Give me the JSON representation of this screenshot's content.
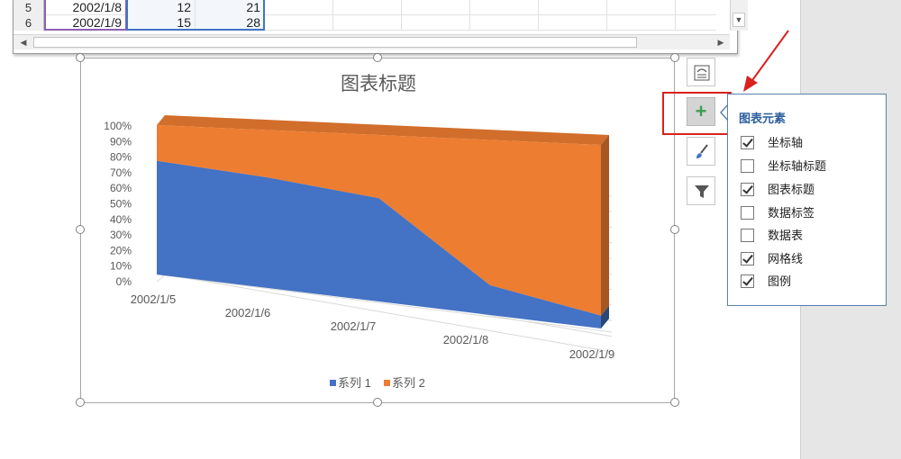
{
  "spreadsheet": {
    "rows": [
      {
        "num": "5",
        "date": "2002/1/8",
        "v1": "12",
        "v2": "21"
      },
      {
        "num": "6",
        "date": "2002/1/9",
        "v1": "15",
        "v2": "28"
      }
    ],
    "scroll_down_icon": "triangle-down",
    "scroll_left_icon": "triangle-left",
    "scroll_right_icon": "triangle-right"
  },
  "chart": {
    "title": "图表标题"
  },
  "chart_data": {
    "type": "area",
    "stacked": "percent",
    "three_d": true,
    "categories": [
      "2002/1/5",
      "2002/1/6",
      "2002/1/7",
      "2002/1/8",
      "2002/1/9"
    ],
    "series": [
      {
        "name": "系列 1",
        "values": [
          76,
          70,
          62,
          17,
          7
        ],
        "color": "#4472c4"
      },
      {
        "name": "系列 2",
        "values": [
          24,
          30,
          38,
          83,
          93
        ],
        "color": "#ed7d31"
      }
    ],
    "title": "图表标题",
    "xlabel": "",
    "ylabel": "",
    "ylim": [
      0,
      100
    ],
    "y_ticks": [
      "0%",
      "10%",
      "20%",
      "30%",
      "40%",
      "50%",
      "60%",
      "70%",
      "80%",
      "90%",
      "100%"
    ],
    "grid": true,
    "legend": "bottom"
  },
  "tools": {
    "layout_icon": "chart-layout-icon",
    "add_icon": "plus-icon",
    "add_glyph": "+",
    "style_icon": "brush-icon",
    "filter_icon": "filter-icon"
  },
  "flyout": {
    "title": "图表元素",
    "options": [
      {
        "label": "坐标轴",
        "checked": true
      },
      {
        "label": "坐标轴标题",
        "checked": false
      },
      {
        "label": "图表标题",
        "checked": true
      },
      {
        "label": "数据标签",
        "checked": false
      },
      {
        "label": "数据表",
        "checked": false
      },
      {
        "label": "网格线",
        "checked": true
      },
      {
        "label": "图例",
        "checked": true
      }
    ]
  },
  "colors": {
    "accent_red": "#d9211f",
    "series1": "#4472c4",
    "series2": "#ed7d31",
    "flyout_title": "#2c5e9e"
  }
}
